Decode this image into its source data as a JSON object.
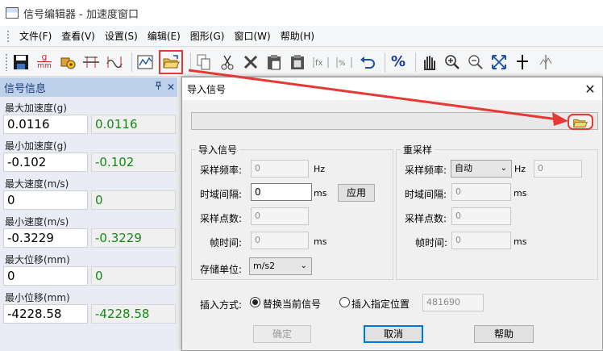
{
  "window": {
    "title": "信号编辑器 - 加速度窗口"
  },
  "menu": [
    "文件(F)",
    "查看(V)",
    "设置(S)",
    "编辑(E)",
    "图形(G)",
    "窗口(W)",
    "帮助(H)"
  ],
  "toolbar": {
    "icons": [
      "save-icon",
      "gram-mm-icon",
      "cube-gear-icon",
      "waveform-markers-icon",
      "waveform-window-icon",
      "signal-chart-icon",
      "open-folder-icon",
      "copy-icon",
      "cut-icon",
      "delete-icon",
      "paste-icon",
      "paste-special-icon",
      "filter-fx-icon",
      "filter-percent-icon",
      "undo-icon",
      "percent-icon",
      "hand-pan-icon",
      "zoom-in-icon",
      "zoom-out-icon",
      "fit-view-icon",
      "crosshair-icon",
      "peak-marker-icon"
    ],
    "gram_top": "g",
    "gram_bottom": "mm",
    "percent_label": "%"
  },
  "panel": {
    "title": "信号信息",
    "pin": "📌",
    "close": "✕",
    "stats": [
      {
        "label": "最大加速度(g)",
        "value": "0.0116",
        "value2": "0.0116"
      },
      {
        "label": "最小加速度(g)",
        "value": "-0.102",
        "value2": "-0.102"
      },
      {
        "label": "最大速度(m/s)",
        "value": "0",
        "value2": "0"
      },
      {
        "label": "最小速度(m/s)",
        "value": "-0.3229",
        "value2": "-0.3229"
      },
      {
        "label": "最大位移(mm)",
        "value": "0",
        "value2": "0"
      },
      {
        "label": "最小位移(mm)",
        "value": "-4228.58",
        "value2": "-4228.58"
      }
    ]
  },
  "dialog": {
    "title": "导入信号",
    "close": "✕",
    "path": "",
    "import_group": {
      "title": "导入信号",
      "sample_rate_label": "采样频率:",
      "sample_rate_value": "0",
      "sample_rate_unit": "Hz",
      "interval_label": "时域间隔:",
      "interval_value": "0",
      "interval_unit": "ms",
      "apply_button": "应用",
      "points_label": "采样点数:",
      "points_value": "0",
      "frame_label": "帧时间:",
      "frame_value": "0",
      "frame_unit": "ms",
      "storage_label": "存储单位:",
      "storage_value": "m/s2"
    },
    "resample_group": {
      "title": "重采样",
      "sample_rate_label": "采样频率:",
      "sample_rate_select": "自动",
      "sample_rate_unit": "Hz",
      "sample_rate_value": "0",
      "interval_label": "时域间隔:",
      "interval_value": "0",
      "interval_unit": "ms",
      "points_label": "采样点数:",
      "points_value": "0",
      "frame_label": "帧时间:",
      "frame_value": "0",
      "frame_unit": "ms"
    },
    "insert_mode_label": "插入方式:",
    "insert_replace": "替换当前信号",
    "insert_position": "插入指定位置",
    "insert_position_value": "481690",
    "ok_button": "确定",
    "cancel_button": "取消",
    "help_button": "帮助"
  },
  "colors": {
    "highlight": "#e53935",
    "panel_header": "#bed1ea",
    "value_green": "#128a12"
  }
}
